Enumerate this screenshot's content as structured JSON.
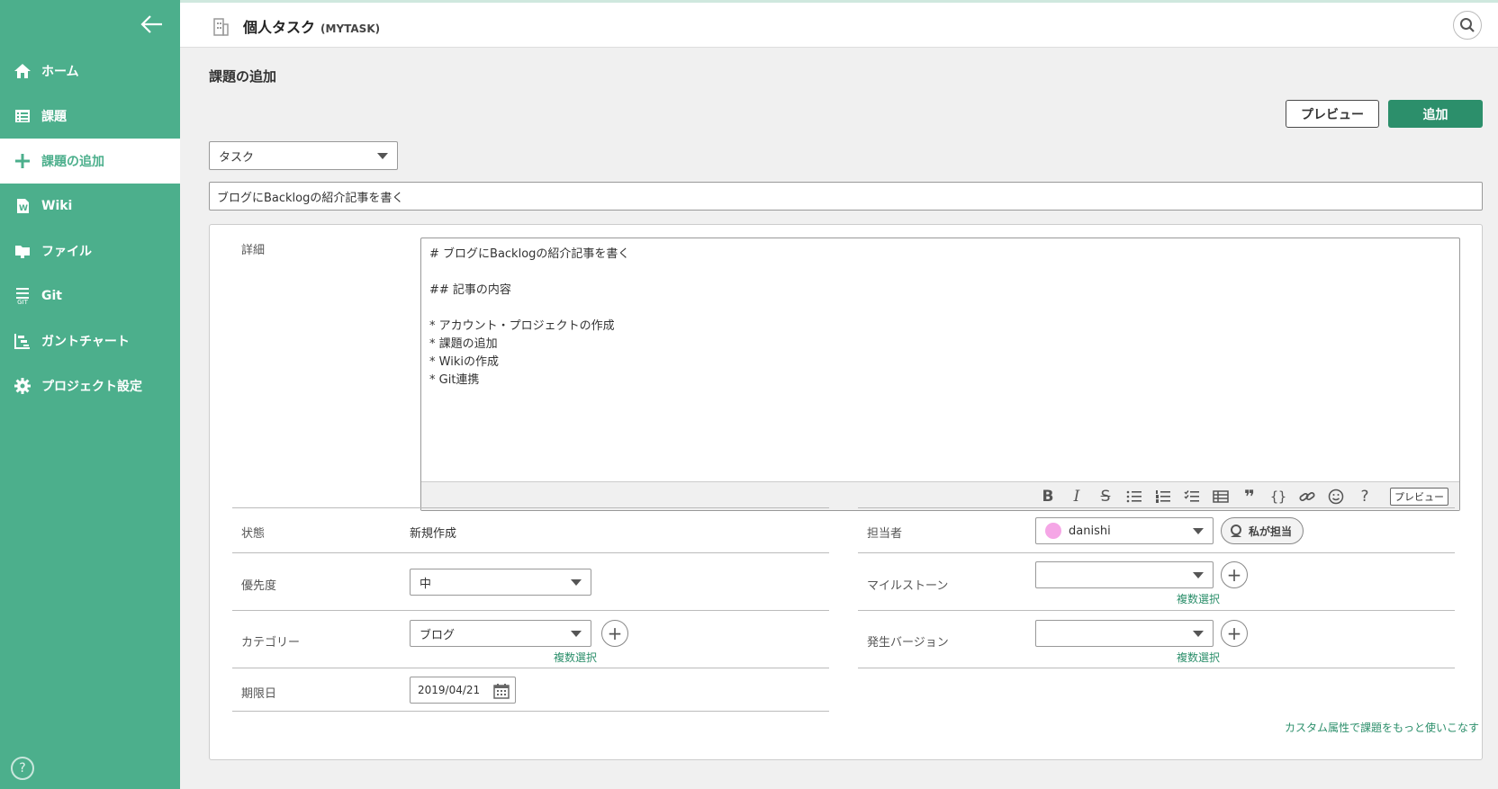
{
  "sidebar": {
    "items": [
      {
        "label": "ホーム",
        "icon": "home-icon"
      },
      {
        "label": "課題",
        "icon": "list-icon"
      },
      {
        "label": "課題の追加",
        "icon": "plus-icon"
      },
      {
        "label": "Wiki",
        "icon": "wiki-icon"
      },
      {
        "label": "ファイル",
        "icon": "folder-icon"
      },
      {
        "label": "Git",
        "icon": "git-icon",
        "sub": "GIT"
      },
      {
        "label": "ガントチャート",
        "icon": "gantt-icon"
      },
      {
        "label": "プロジェクト設定",
        "icon": "gear-icon"
      }
    ],
    "active_index": 2,
    "help": "?"
  },
  "header": {
    "project_name": "個人タスク",
    "project_key": "(MYTASK)"
  },
  "page": {
    "title": "課題の追加",
    "preview_label": "プレビュー",
    "add_label": "追加",
    "issue_type": "タスク",
    "summary": "ブログにBacklogの紹介記事を書く",
    "detail_label": "詳細",
    "description": "# ブログにBacklogの紹介記事を書く\n\n## 記事の内容\n\n* アカウント・プロジェクトの作成\n* 課題の追加\n* Wikiの作成\n* Git連携",
    "toolbar": {
      "bold": "B",
      "italic": "I",
      "strike": "S",
      "help": "?",
      "preview": "プレビュー"
    },
    "fields": {
      "status_label": "状態",
      "status_value": "新規作成",
      "priority_label": "優先度",
      "priority_value": "中",
      "category_label": "カテゴリー",
      "category_value": "ブログ",
      "due_label": "期限日",
      "due_value": "2019/04/21",
      "assignee_label": "担当者",
      "assignee_value": "danishi",
      "assign_me": "私が担当",
      "milestone_label": "マイルストーン",
      "version_label": "発生バージョン",
      "multi_select": "複数選択"
    },
    "custom_link": "カスタム属性で課題をもっと使いこなす"
  },
  "colors": {
    "sidebar": "#4caf8c",
    "primary_button": "#2c8f6b",
    "link": "#2c8f6b"
  }
}
